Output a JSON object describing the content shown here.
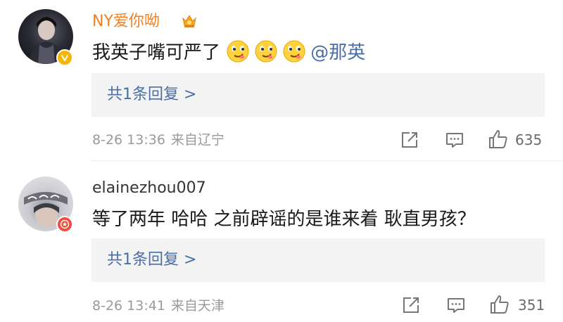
{
  "comments": [
    {
      "username": "NY爱你呦",
      "username_color": "#f57f20",
      "crown_icon": "crown-icon",
      "badge_icon": "verified-v-icon",
      "badge_color": "#f6b500",
      "text": "我英子嘴可严了",
      "emoji": [
        "smirk-emoji",
        "smirk-emoji",
        "smirk-emoji"
      ],
      "mention": "@那英",
      "replies_label": "共1条回复 >",
      "date": "8-26 13:36",
      "source": "来自辽宁",
      "likes": "635"
    },
    {
      "username": "elainezhou007",
      "username_color": "#333333",
      "badge_icon": "star-badge-icon",
      "badge_color": "#f04c3b",
      "text": "等了两年 哈哈 之前辟谣的是谁来着 耿直男孩？",
      "replies_label": "共1条回复 >",
      "date": "8-26 13:41",
      "source": "来自天津",
      "likes": "351"
    }
  ],
  "colors": {
    "link": "#4a6ea5",
    "meta": "#9a9a9a",
    "reply_bg": "#f3f3f3"
  }
}
